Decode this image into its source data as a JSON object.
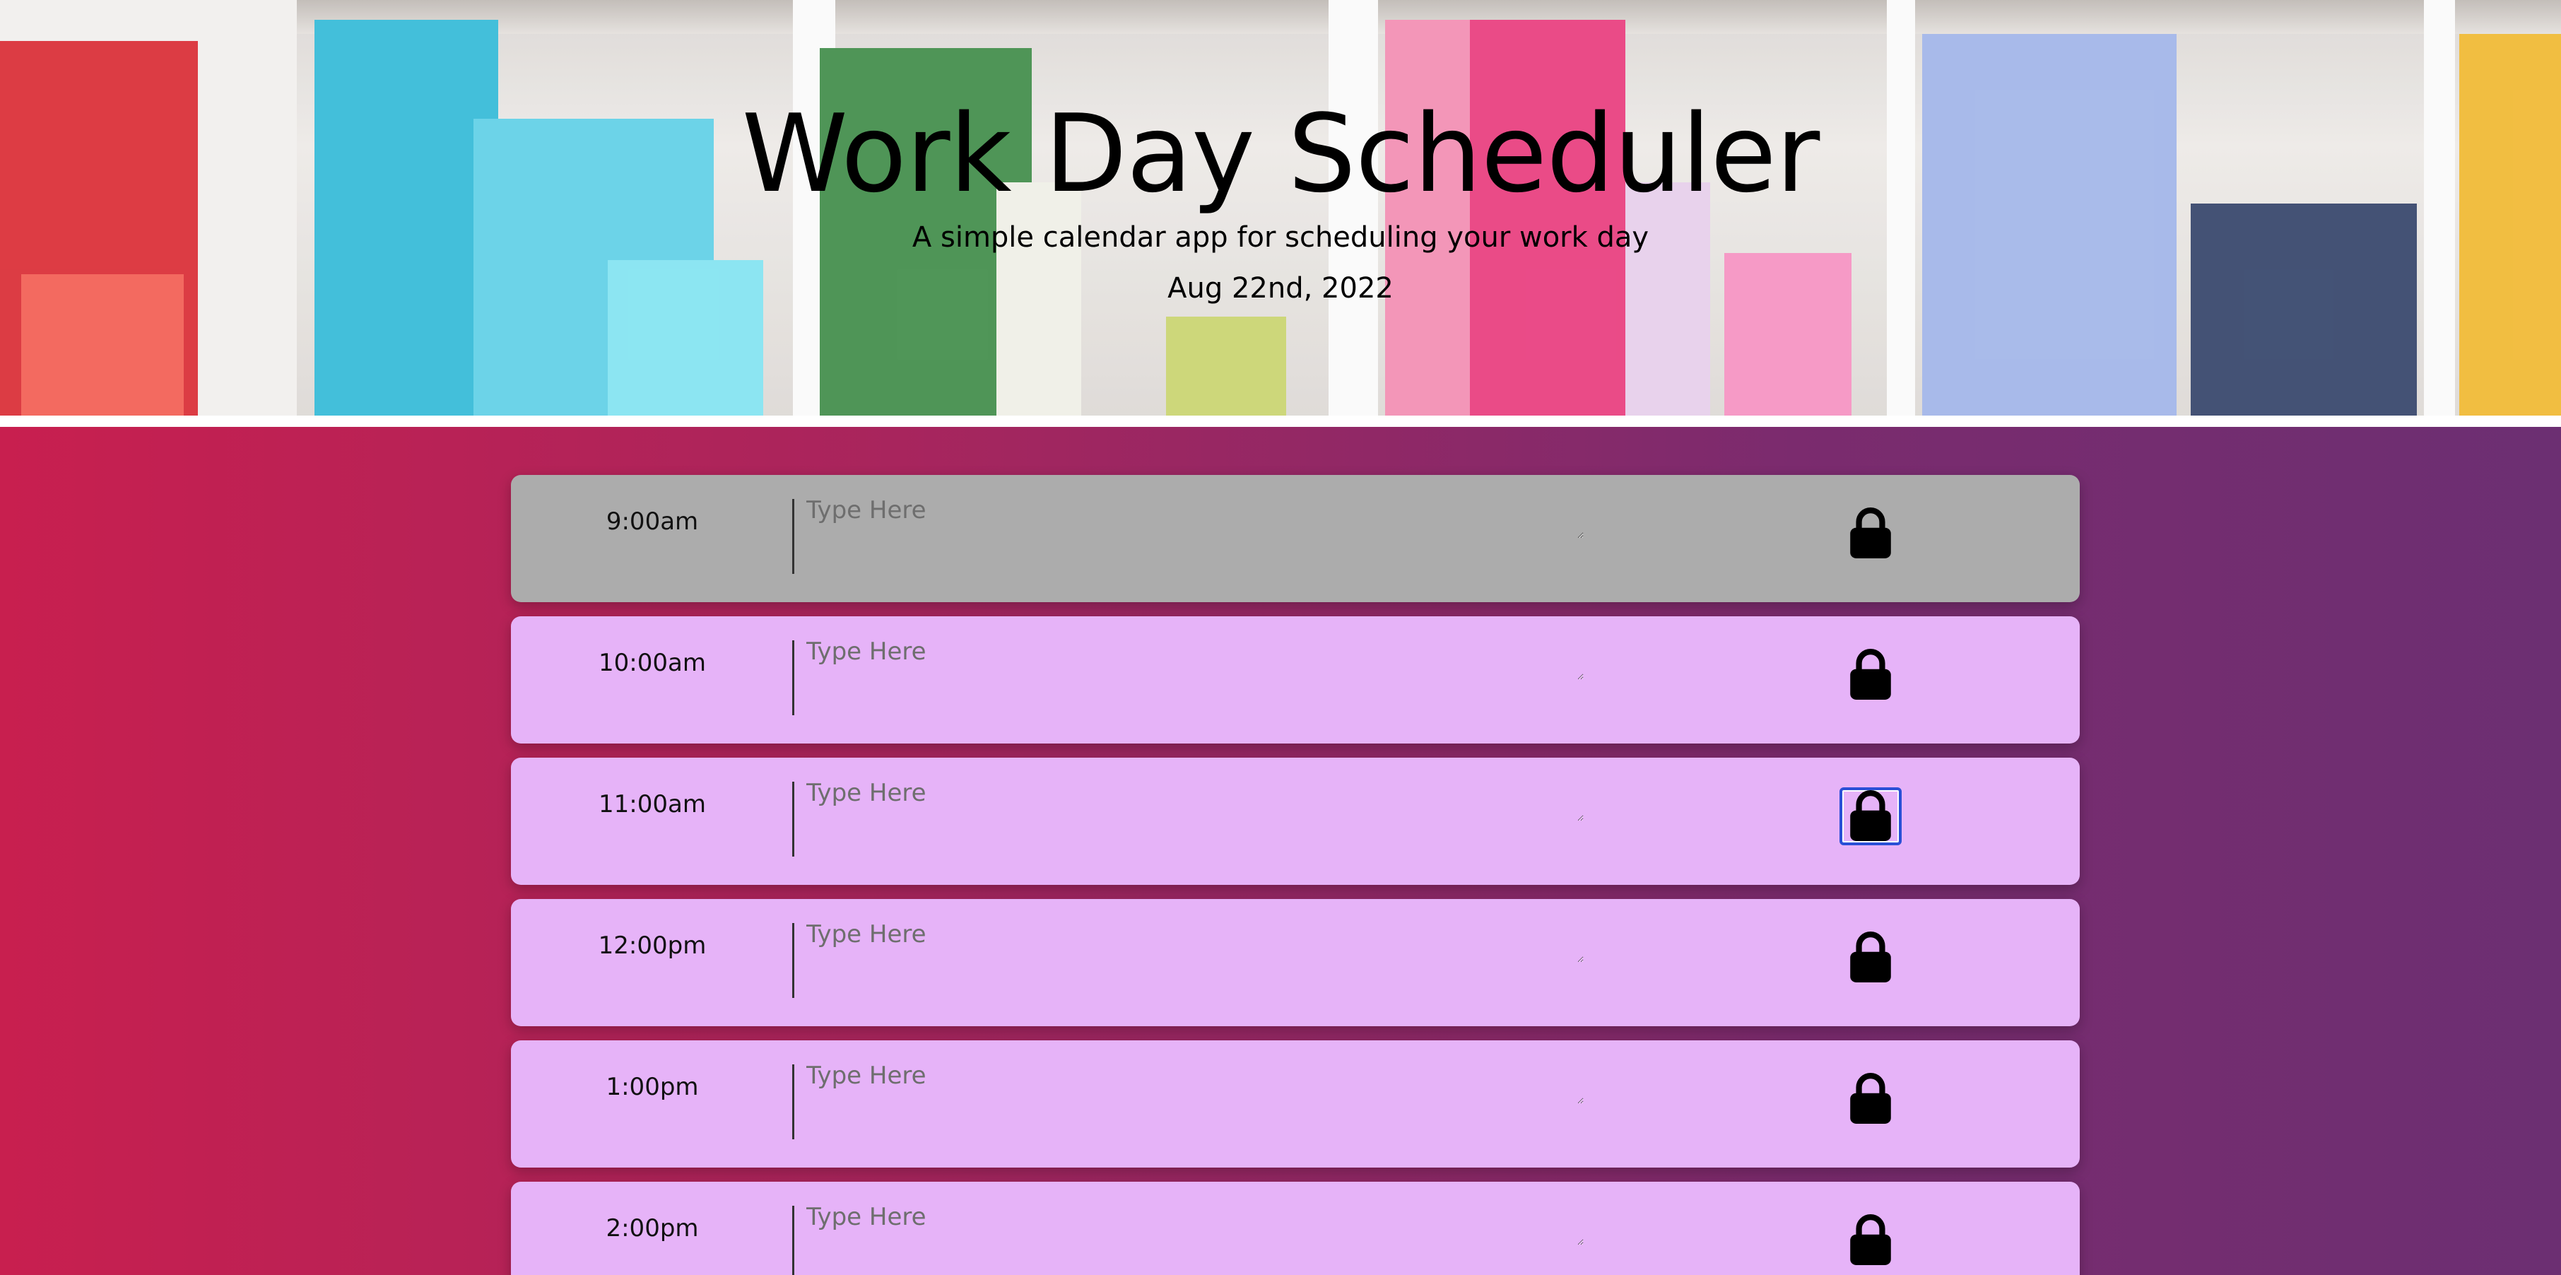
{
  "header": {
    "title": "Work Day Scheduler",
    "subtitle": "A simple calendar app for scheduling your work day",
    "date": "Aug 22nd, 2022"
  },
  "colors": {
    "past": "#acacac",
    "future": "#e6b3f8",
    "gradient_start": "#c81f4f",
    "gradient_end": "#6c2f72"
  },
  "schedule": {
    "placeholder": "Type Here",
    "save_icon": "lock-icon",
    "rows": [
      {
        "hour": "9:00am",
        "state": "past"
      },
      {
        "hour": "10:00am",
        "state": "future"
      },
      {
        "hour": "11:00am",
        "state": "future"
      },
      {
        "hour": "12:00pm",
        "state": "future"
      },
      {
        "hour": "1:00pm",
        "state": "future"
      },
      {
        "hour": "2:00pm",
        "state": "future"
      }
    ]
  }
}
